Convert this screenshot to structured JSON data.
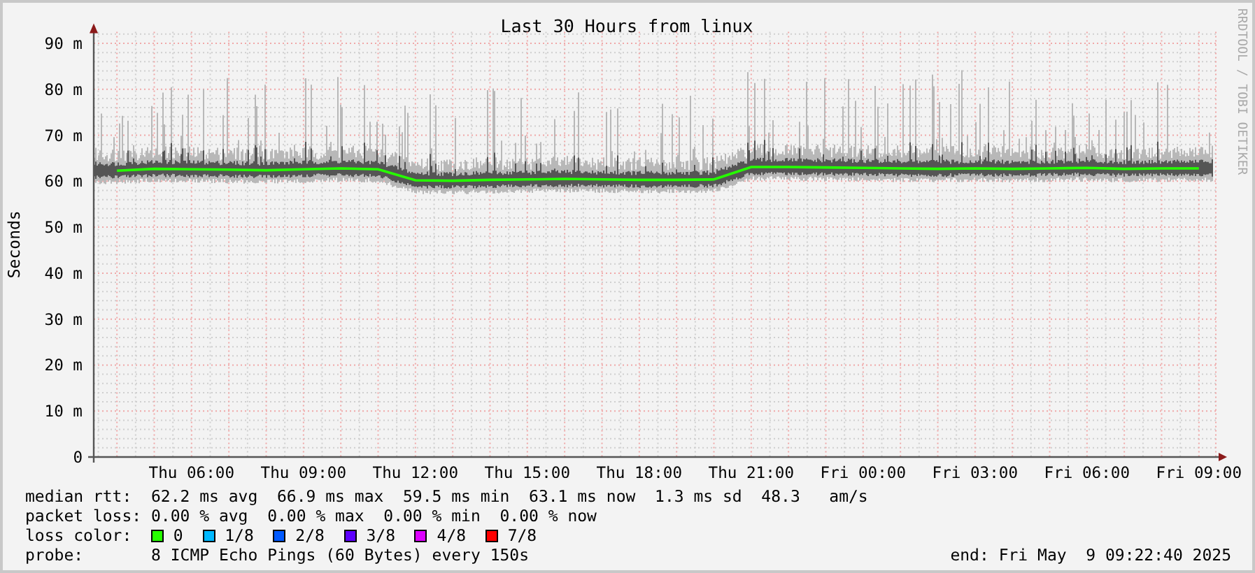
{
  "chart": {
    "credit": "RRDTOOL / TOBI OETIKER",
    "chart_data": {
      "type": "line",
      "title": "Last 30 Hours from linux",
      "ylabel": "Seconds",
      "categories": [
        null,
        null,
        "Thu 06:00",
        null,
        null,
        "Thu 09:00",
        null,
        null,
        "Thu 12:00",
        null,
        null,
        "Thu 15:00",
        null,
        null,
        "Thu 18:00",
        null,
        null,
        "Thu 21:00",
        null,
        null,
        "Fri 00:00",
        null,
        null,
        "Fri 03:00",
        null,
        null,
        "Fri 06:00",
        null,
        null,
        "Fri 09:00"
      ],
      "grid": true,
      "series": [
        {
          "color": "#26ff00",
          "values": [
            62.3,
            62.7,
            62.6,
            62.5,
            62.4,
            62.6,
            62.8,
            62.6,
            60.2,
            60.1,
            60.3,
            60.4,
            60.5,
            60.4,
            60.3,
            60.3,
            60.4,
            63.1,
            63.1,
            63,
            62.9,
            62.8,
            62.7,
            62.8,
            62.7,
            62.8,
            62.9,
            62.7,
            62.8,
            62.8
          ]
        }
      ],
      "ylim": [
        0,
        92.5
      ],
      "yticks": [
        {
          "value": 0,
          "label": "0"
        },
        {
          "value": 10,
          "label": "10 m"
        },
        {
          "value": 20,
          "label": "20 m"
        },
        {
          "value": 30,
          "label": "30 m"
        },
        {
          "value": 40,
          "label": "40 m"
        },
        {
          "value": 50,
          "label": "50 m"
        },
        {
          "value": 60,
          "label": "60 m"
        },
        {
          "value": 70,
          "label": "70 m"
        },
        {
          "value": 80,
          "label": "80 m"
        },
        {
          "value": 90,
          "label": "90 m"
        }
      ]
    }
  },
  "legend": {
    "median_rtt": {
      "label": "median rtt:",
      "text": "62.2 ms avg  66.9 ms max  59.5 ms min  63.1 ms now  1.3 ms sd  48.3   am/s"
    },
    "packet_loss": {
      "label": "packet loss:",
      "text": "0.00 % avg  0.00 % max  0.00 % min  0.00 % now"
    },
    "loss_color": {
      "label": "loss color:",
      "items": [
        {
          "label": "0",
          "color": "#26ff00"
        },
        {
          "label": "1/8",
          "color": "#00b8ff"
        },
        {
          "label": "2/8",
          "color": "#0059ff"
        },
        {
          "label": "3/8",
          "color": "#5e00ff"
        },
        {
          "label": "4/8",
          "color": "#dd00ff"
        },
        {
          "label": "7/8",
          "color": "#ff0000"
        }
      ]
    },
    "probe": {
      "label": "probe:",
      "text": "8 ICMP Echo Pings (60 Bytes) every 150s"
    },
    "end": "end: Fri May  9 09:22:40 2025"
  }
}
